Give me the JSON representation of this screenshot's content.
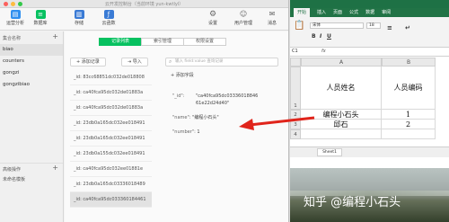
{
  "window": {
    "title": "云开发控制台（当前环境 yun-kwtlyl）"
  },
  "toolbar": {
    "left": [
      {
        "label": "运营分析",
        "icon": "chart-icon",
        "color": "#2f8fef"
      },
      {
        "label": "数据库",
        "icon": "database-icon",
        "color": "#07c160"
      },
      {
        "label": "存储",
        "icon": "storage-icon",
        "color": "#3a7bd5"
      },
      {
        "label": "云函数",
        "icon": "function-icon",
        "color": "#3a7bd5"
      }
    ],
    "right": [
      {
        "label": "设置",
        "icon": "gear-icon"
      },
      {
        "label": "用户管理",
        "icon": "user-icon"
      },
      {
        "label": "消息",
        "icon": "message-icon"
      }
    ]
  },
  "sidebar": {
    "header": "集合名称",
    "collections": [
      "biao",
      "counters",
      "gongzi",
      "gongzibiao"
    ],
    "footer": [
      "高级操作",
      "未命名模板"
    ]
  },
  "tabs": [
    "记录列表",
    "索引管理",
    "权限设置"
  ],
  "actions": {
    "add_record": "添加记录",
    "import": "导入",
    "search_placeholder": "输入 field:value 查询记录"
  },
  "records": [
    "_id: 83cc68851dc032de018808",
    "_id: ca40fca95dc032de01883a",
    "_id: ca40fca95dc032de01883a",
    "_id: 23db0a165dc032ee018491",
    "_id: 23db0a165dc032ee018491",
    "_id: 23db0a155dc032ee018491",
    "_id: ca40fca95dc032ee01881e",
    "_id: 23db0a165dc03336018489",
    "_id: ca40fca95dc033360184461"
  ],
  "detail": {
    "add_field": "添加字段",
    "id_key": "\"_id\":",
    "id_value": "\"ca40fca95dc03336018846\n61e22d24d40\"",
    "name_key": "\"name\":",
    "name_value": "\"编程小石头\"",
    "number_key": "\"number\":",
    "number_value": "1"
  },
  "excel": {
    "menus": [
      "开始",
      "插入",
      "页面",
      "公式",
      "数据",
      "审阅"
    ],
    "active_menu": "开始",
    "font_name": "宋体",
    "font_size": "18",
    "cell_ref": "C1",
    "fx": "fx",
    "columns": [
      "A",
      "B"
    ],
    "rows": [
      "1",
      "2",
      "3",
      "4"
    ],
    "headers": [
      "人员姓名",
      "人员编码"
    ],
    "data": [
      [
        "编程小石头",
        "1"
      ],
      [
        "邱石",
        "2"
      ]
    ],
    "sheet_tab": "Sheet1"
  },
  "watermark": "知乎 @编程小石头"
}
